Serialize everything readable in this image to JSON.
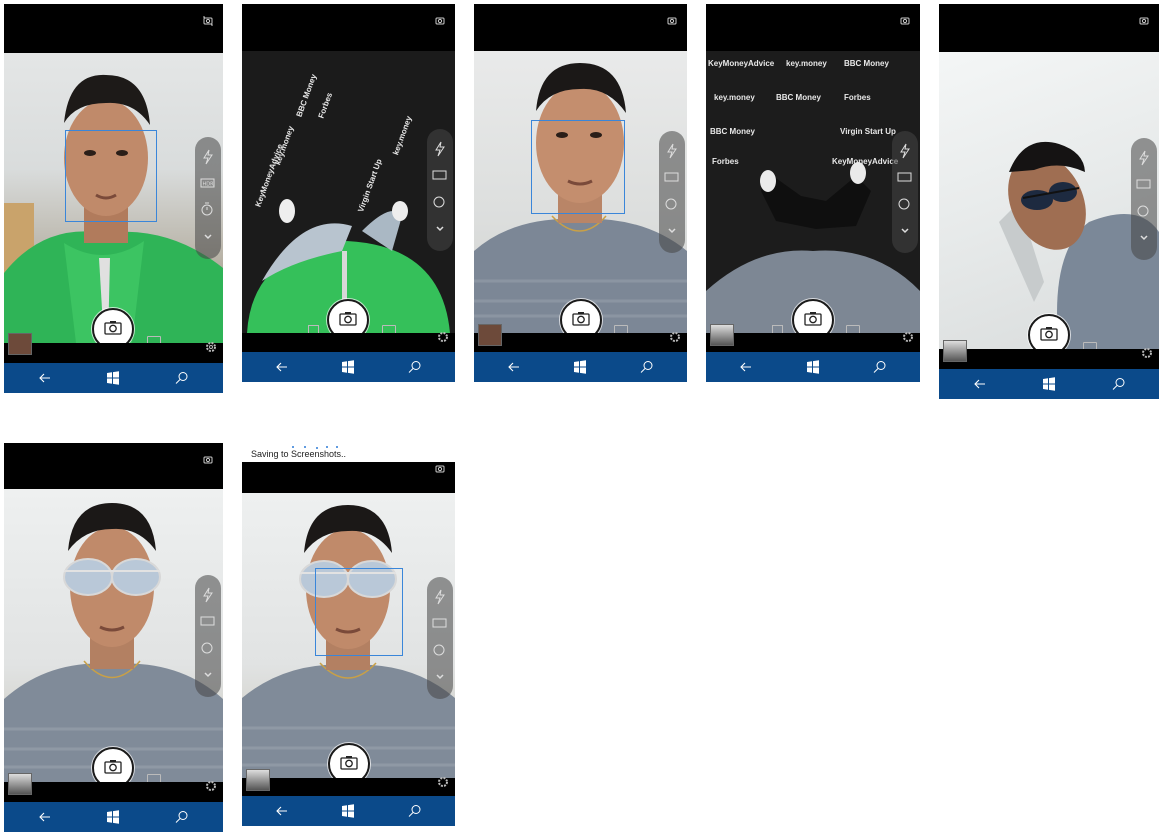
{
  "status": {
    "saving_text": "Saving to Screenshots.."
  },
  "banner_text": [
    "key.money",
    "BBC Money",
    "Forbes",
    "Virgin Start Up",
    "KeyMoneyAdvice"
  ],
  "icons": {
    "flash": "flash-auto-icon",
    "hdr": "hdr-icon",
    "timer": "timer-icon",
    "expand": "chevron-down-icon",
    "shutter": "camera-icon",
    "swap": "camera-swap-icon",
    "settings": "gear-icon",
    "back": "back-arrow-icon",
    "start": "windows-logo-icon",
    "search": "search-icon"
  },
  "colors": {
    "navbar": "#0b4a8a",
    "face_box": "#3a86d9",
    "background": "#ffffff"
  }
}
